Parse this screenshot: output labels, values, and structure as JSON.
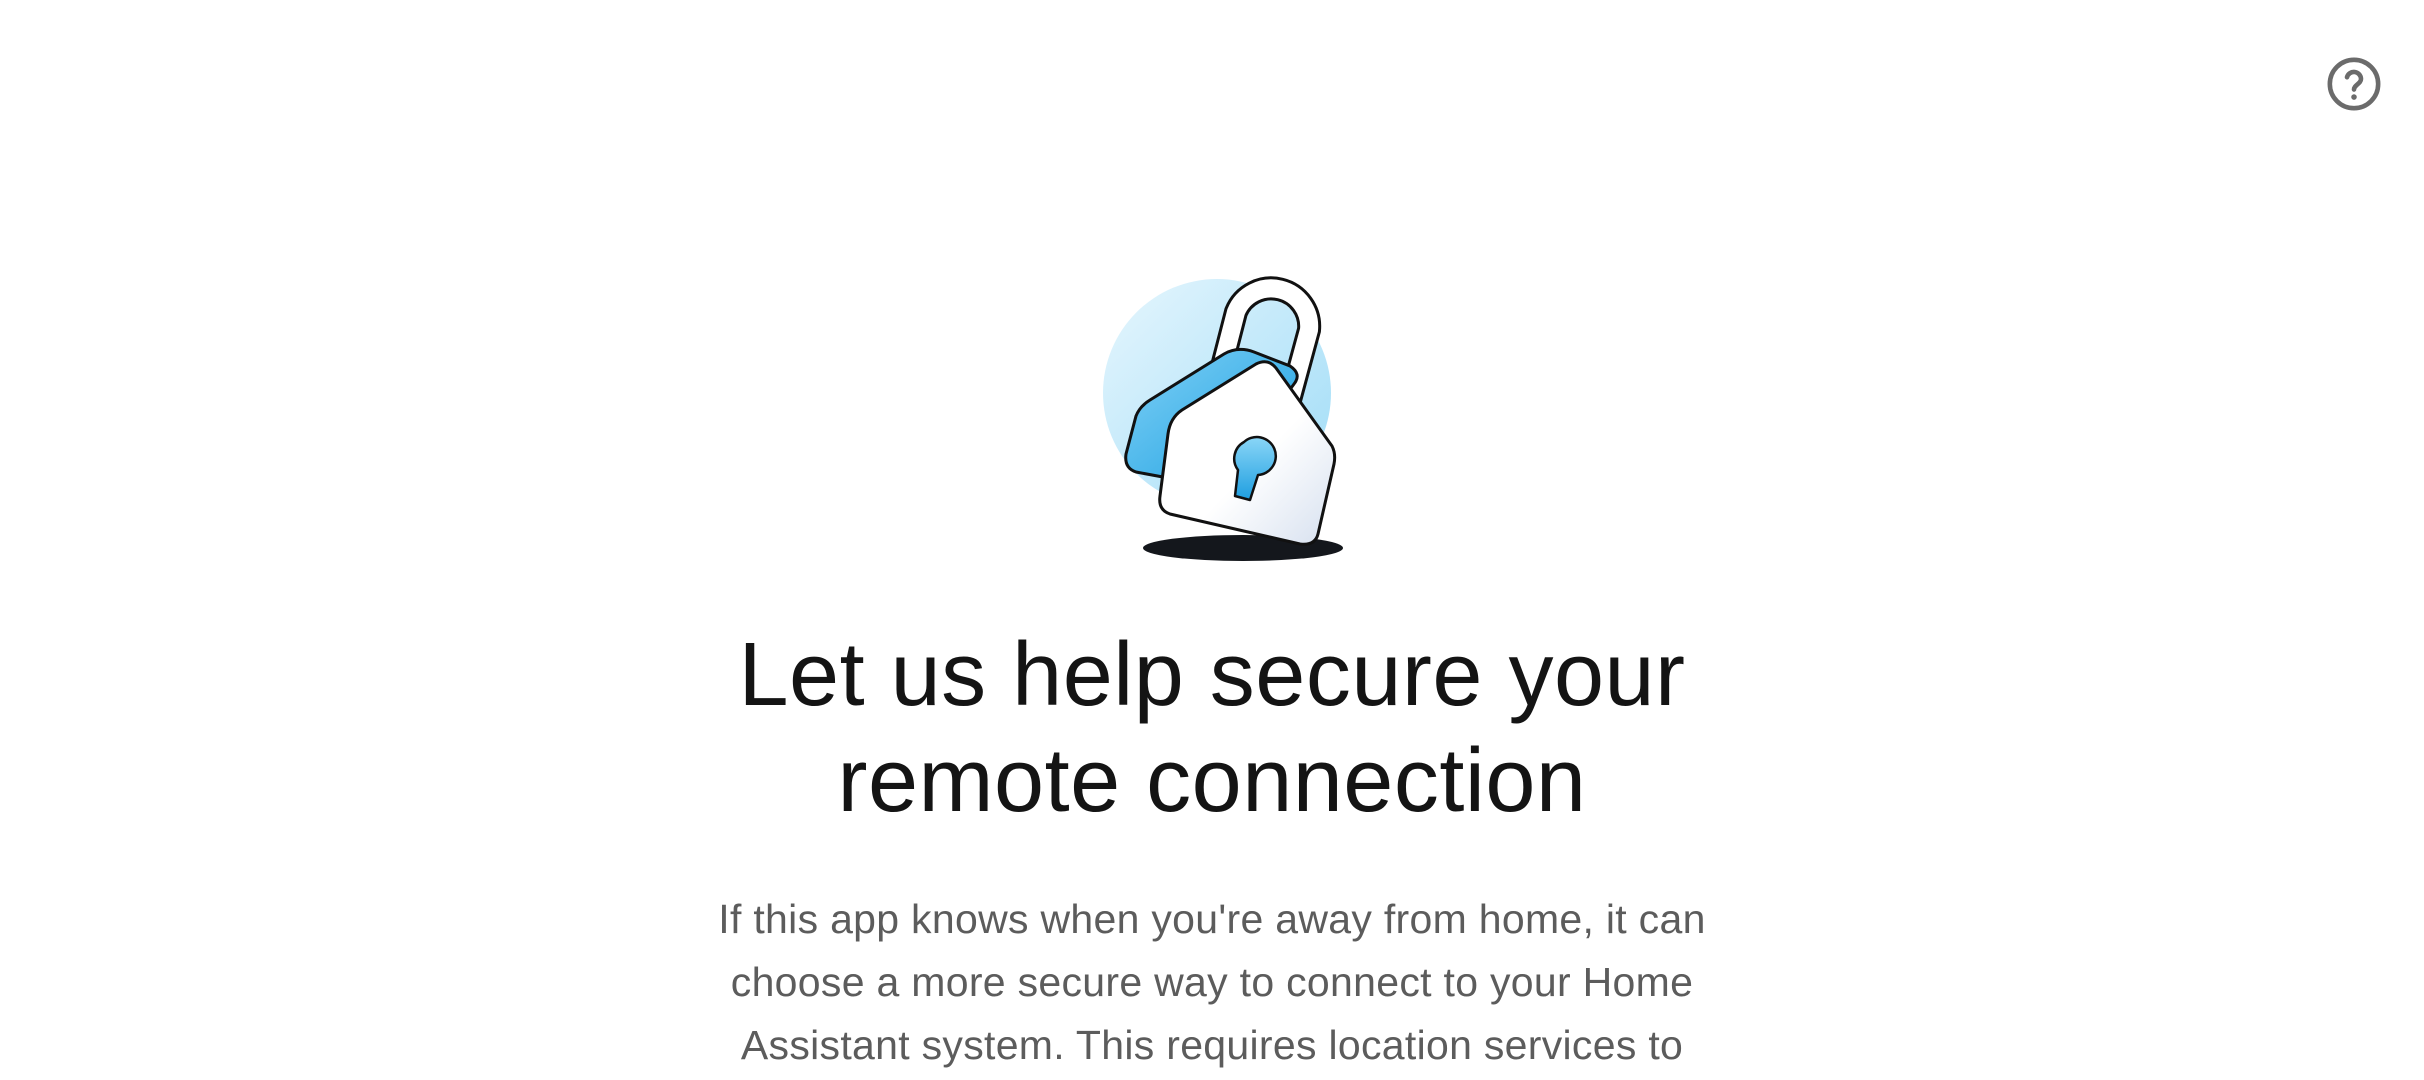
{
  "header": {
    "help_icon": "help-circle-icon",
    "help_color": "#6b6b6b"
  },
  "illustration": {
    "icon": "padlock-illustration-icon",
    "accent_color": "#29b6f6",
    "circle_color": "#bfe8fb"
  },
  "main": {
    "title": "Let us help secure your remote connection",
    "description": "If this app knows when you're away from home, it can choose a more secure way to connect to your Home Assistant system. This requires location services to"
  }
}
